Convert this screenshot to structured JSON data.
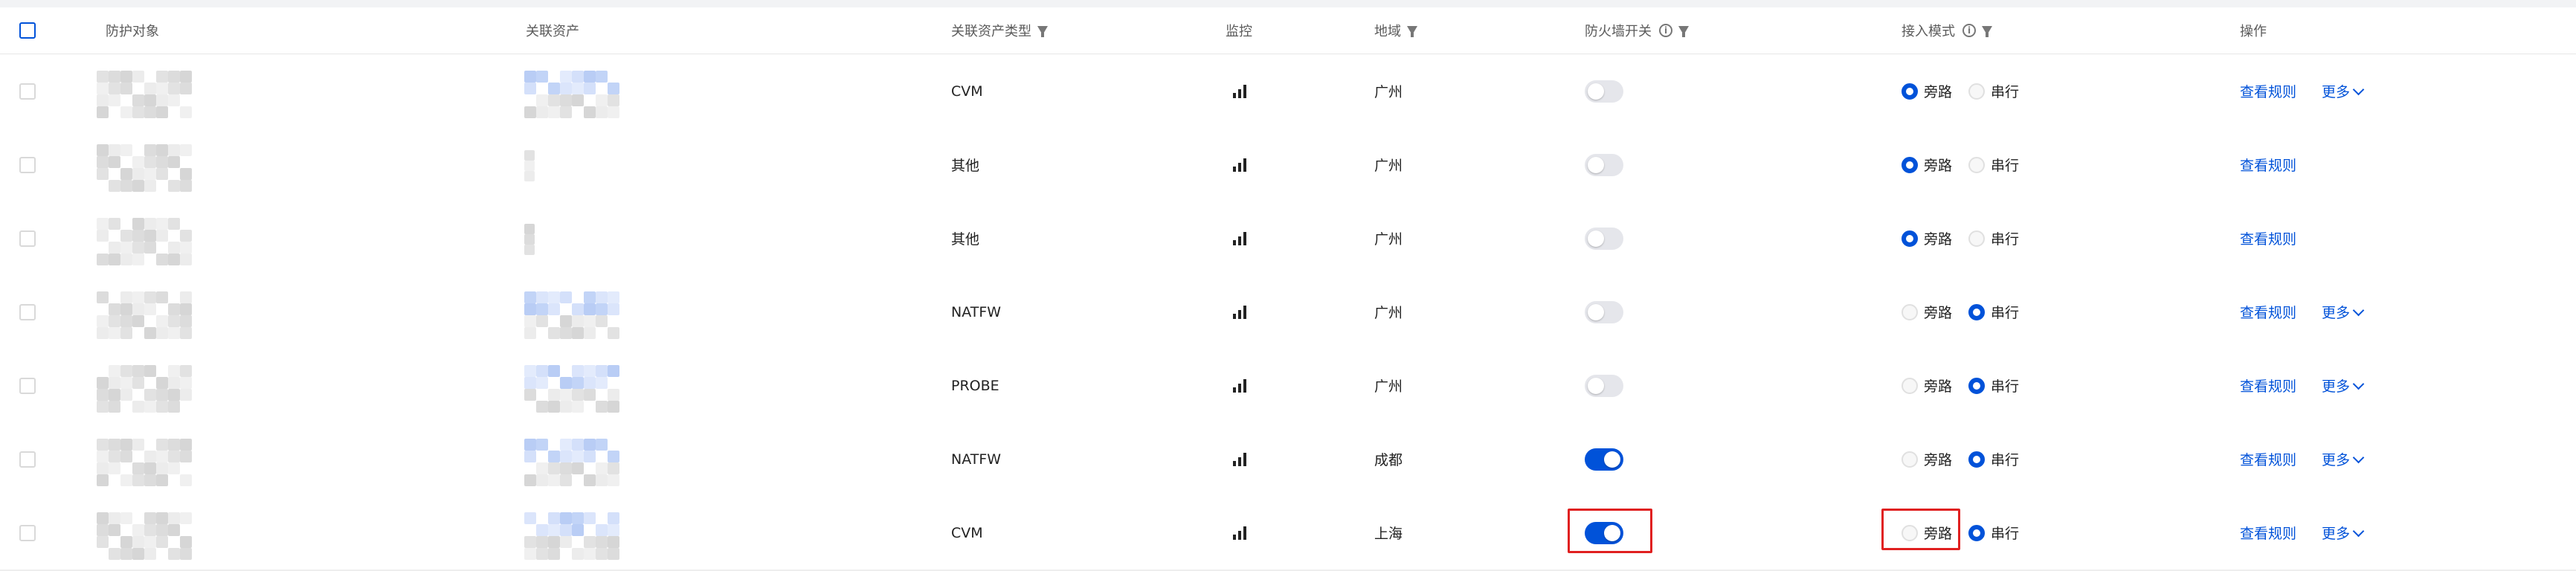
{
  "header": {
    "protect_target": "防护对象",
    "related_asset": "关联资产",
    "asset_type": "关联资产类型",
    "monitor": "监控",
    "region": "地域",
    "firewall_switch": "防火墙开关",
    "access_mode": "接入模式",
    "actions": "操作"
  },
  "radio_labels": {
    "bypass": "旁路",
    "serial": "串行"
  },
  "action_labels": {
    "view_rules": "查看规则",
    "more": "更多"
  },
  "accent_color": "#0052d9",
  "highlight_color": "#e02020",
  "rows": [
    {
      "asset_type": "CVM",
      "region": "广州",
      "firewall_on": false,
      "mode": "bypass",
      "has_more": true,
      "related_asset_shown": true
    },
    {
      "asset_type": "其他",
      "region": "广州",
      "firewall_on": false,
      "mode": "bypass",
      "has_more": false,
      "related_asset_shown": false
    },
    {
      "asset_type": "其他",
      "region": "广州",
      "firewall_on": false,
      "mode": "bypass",
      "has_more": false,
      "related_asset_shown": false
    },
    {
      "asset_type": "NATFW",
      "region": "广州",
      "firewall_on": false,
      "mode": "serial",
      "has_more": true,
      "related_asset_shown": true
    },
    {
      "asset_type": "PROBE",
      "region": "广州",
      "firewall_on": false,
      "mode": "serial",
      "has_more": true,
      "related_asset_shown": true
    },
    {
      "asset_type": "NATFW",
      "region": "成都",
      "firewall_on": true,
      "mode": "serial",
      "has_more": true,
      "related_asset_shown": true
    },
    {
      "asset_type": "CVM",
      "region": "上海",
      "firewall_on": true,
      "mode": "serial",
      "has_more": true,
      "related_asset_shown": true
    }
  ],
  "highlighted_row_index": 6
}
